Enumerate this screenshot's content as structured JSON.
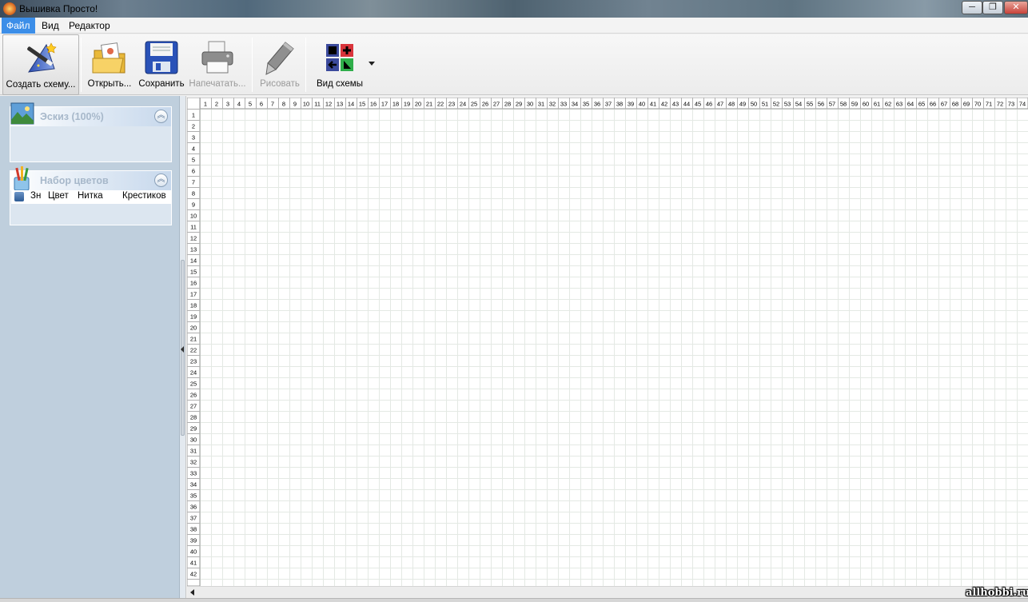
{
  "window": {
    "title": "Вышивка Просто!",
    "minimize": "─",
    "maximize": "❐",
    "close": "✕"
  },
  "menu": {
    "file": "Файл",
    "view": "Вид",
    "editor": "Редактор"
  },
  "toolbar": {
    "create": "Создать схему...",
    "open": "Открыть...",
    "save": "Сохранить",
    "print": "Напечатать...",
    "draw": "Рисовать",
    "view_scheme": "Вид схемы"
  },
  "panels": {
    "sketch": {
      "title": "Эскиз (100%)",
      "icon": "landscape-image-icon"
    },
    "colors": {
      "title": "Набор цветов",
      "icon": "paint-brushes-icon",
      "columns": [
        "Зн",
        "Цвет",
        "Нитка",
        "Крестиков"
      ]
    }
  },
  "grid": {
    "columns_visible": 74,
    "rows_visible": 42,
    "accent_color": "#cfd8cf"
  },
  "watermark": "allhobbi.ru"
}
